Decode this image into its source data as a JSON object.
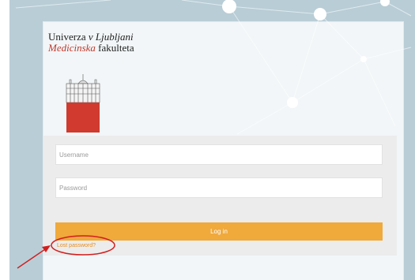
{
  "logo": {
    "line1_a": "Univerza ",
    "line1_b": "v Ljubljani",
    "line2_a": "Medicinska",
    "line2_b": " fakulteta",
    "emblem_icon": "university-building-emblem-icon"
  },
  "login": {
    "username_placeholder": "Username",
    "password_placeholder": "Password",
    "login_label": "Log in",
    "lost_password_label": "Lost password?"
  },
  "colors": {
    "accent": "#f0a93b",
    "link": "#e58c1f",
    "emblem_red": "#d03a2f",
    "annotation_red": "#d11f1f"
  },
  "icons": {
    "annotation_arrow": "arrow-icon",
    "annotation_circle": "highlight-circle-icon"
  }
}
